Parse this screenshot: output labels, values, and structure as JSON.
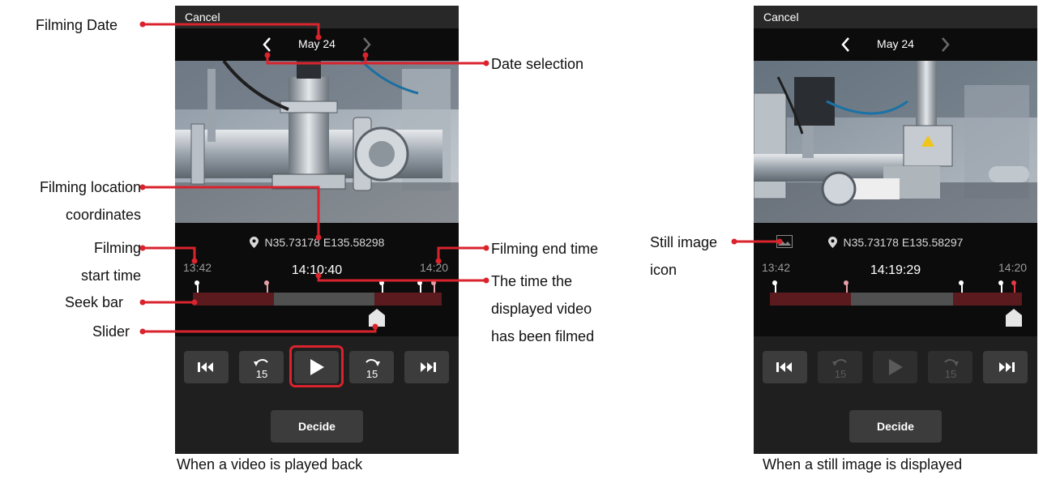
{
  "colors": {
    "accent_red": "#d9232d",
    "seek_recorded": "#5b1a1e",
    "seek_gap": "#505050",
    "marker_pink": "#e8a0a8"
  },
  "video_screen": {
    "cancel_label": "Cancel",
    "date": "May 24",
    "coords_lat": "N35.73178",
    "coords_lon": "E135.58298",
    "start_time": "13:42",
    "end_time": "14:20",
    "current_time": "14:10:40",
    "decide_label": "Decide",
    "caption": "When a video is played back"
  },
  "still_screen": {
    "cancel_label": "Cancel",
    "date": "May 24",
    "coords_lat": "N35.73178",
    "coords_lon": "E135.58297",
    "start_time": "13:42",
    "end_time": "14:20",
    "current_time": "14:19:29",
    "decide_label": "Decide",
    "caption": "When a still image is displayed"
  },
  "controls": {
    "icons": [
      "skip-to-start-icon",
      "rewind-15-icon",
      "play-icon",
      "forward-15-icon",
      "skip-to-end-icon"
    ],
    "skip_seconds": "15"
  },
  "annotations": {
    "filming_date": "Filming Date",
    "date_selection": "Date selection",
    "location_line1": "Filming location",
    "location_line2": "coordinates",
    "start_line1": "Filming",
    "start_line2": "start time",
    "end_time": "Filming end time",
    "seek_bar": "Seek bar",
    "slider": "Slider",
    "displayed_line1": "The time the",
    "displayed_line2": "displayed video",
    "displayed_line3": "has been filmed",
    "still_line1": "Still image",
    "still_line2": "icon"
  }
}
